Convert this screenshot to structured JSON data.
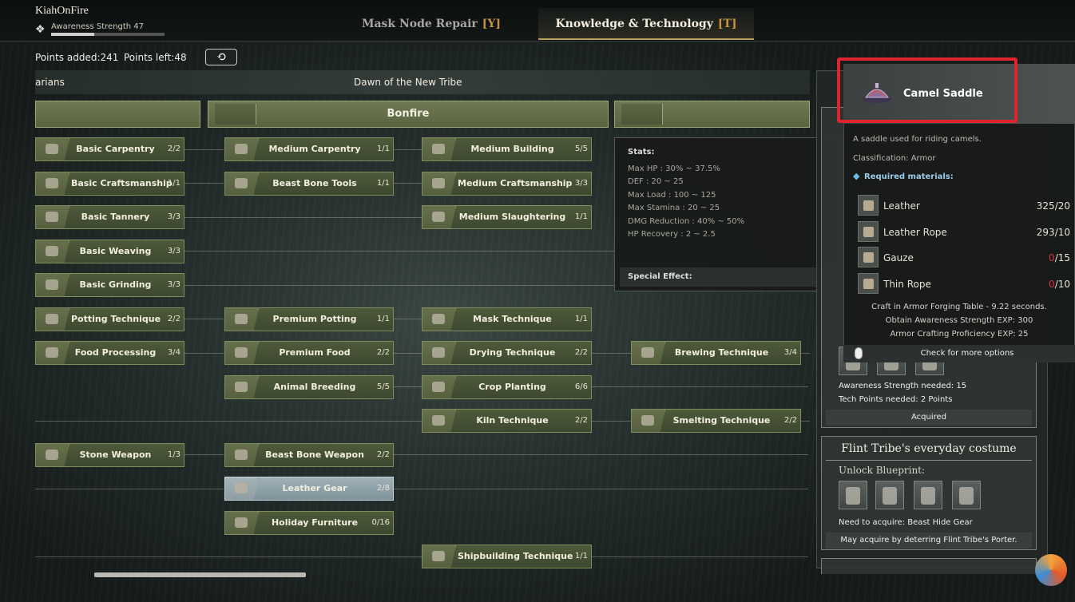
{
  "player": {
    "name": "KiahOnFire",
    "awareness_label": "Awareness Strength 47",
    "awareness_progress": 0.38
  },
  "tabs": [
    {
      "label": "Mask Node Repair",
      "key": "[Y]"
    },
    {
      "label": "Knowledge & Technology",
      "key": "[T]",
      "active": true
    }
  ],
  "points": {
    "added": "Points added:241",
    "left": "Points left:48",
    "reset_icon": "refresh-icon"
  },
  "eras": {
    "prev": "arians",
    "current": "Dawn of the New Tribe"
  },
  "categories": {
    "left": "",
    "center": "Bonfire",
    "right": ""
  },
  "nodes": [
    {
      "label": "Basic Carpentry",
      "count": "2/2"
    },
    {
      "label": "Basic Craftsmanship",
      "count": "1/1"
    },
    {
      "label": "Basic Tannery",
      "count": "3/3"
    },
    {
      "label": "Basic Weaving",
      "count": "3/3"
    },
    {
      "label": "Basic Grinding",
      "count": "3/3"
    },
    {
      "label": "Potting Technique",
      "count": "2/2"
    },
    {
      "label": "Food Processing",
      "count": "3/4"
    },
    {
      "label": "Stone Weapon",
      "count": "1/3"
    },
    {
      "label": "Medium Carpentry",
      "count": "1/1"
    },
    {
      "label": "Beast Bone Tools",
      "count": "1/1"
    },
    {
      "label": "Premium Potting",
      "count": "1/1"
    },
    {
      "label": "Premium Food",
      "count": "2/2"
    },
    {
      "label": "Animal Breeding",
      "count": "5/5"
    },
    {
      "label": "Beast Bone Weapon",
      "count": "2/2"
    },
    {
      "label": "Leather Gear",
      "count": "2/8"
    },
    {
      "label": "Holiday Furniture",
      "count": "0/16"
    },
    {
      "label": "Medium Building",
      "count": "5/5"
    },
    {
      "label": "Medium Craftsmanship",
      "count": "3/3"
    },
    {
      "label": "Medium Slaughtering",
      "count": "1/1"
    },
    {
      "label": "Mask Technique",
      "count": "1/1"
    },
    {
      "label": "Drying Technique",
      "count": "2/2"
    },
    {
      "label": "Crop Planting",
      "count": "6/6"
    },
    {
      "label": "Kiln Technique",
      "count": "2/2"
    },
    {
      "label": "Shipbuilding Technique",
      "count": "1/1"
    },
    {
      "label": "Brewing Technique",
      "count": "3/4"
    },
    {
      "label": "Smelting Technique",
      "count": "2/2"
    }
  ],
  "stats": {
    "title": "Stats:",
    "lines": [
      "Max HP : 30% ~ 37.5%",
      "DEF : 20 ~ 25",
      "Max Load : 100 ~ 125",
      "Max Stamina : 20 ~ 25",
      "DMG Reduction : 40% ~ 50%",
      "HP Recovery : 2 ~ 2.5"
    ],
    "special": "Special Effect:"
  },
  "item": {
    "name": "Camel Saddle",
    "description": "A saddle used for riding camels.",
    "classification": "Classification: Armor",
    "required_label": "Required materials:",
    "materials": [
      {
        "name": "Leather",
        "have": "325",
        "need": "/20",
        "short": false
      },
      {
        "name": "Leather Rope",
        "have": "293",
        "need": "/10",
        "short": false
      },
      {
        "name": "Gauze",
        "have": "0",
        "need": "/15",
        "short": true
      },
      {
        "name": "Thin Rope",
        "have": "0",
        "need": "/10",
        "short": true
      }
    ],
    "craft_info": [
      "Craft in Armor Forging Table - 9.22 seconds.",
      "Obtain Awareness Strength EXP: 300",
      "Armor Crafting Proficiency EXP: 25"
    ],
    "more_options": "Check for more options"
  },
  "right_panel": {
    "awareness_needed": "Awareness Strength needed: 15",
    "tech_points_needed": "Tech Points needed: 2 Points",
    "status": "Acquired",
    "card2_title": "Flint Tribe's everyday costume",
    "unlock_label": "Unlock Blueprint:",
    "need_acquire": "Need to acquire: Beast Hide Gear",
    "may_acquire": "May acquire by deterring Flint Tribe's Porter."
  },
  "colors": {
    "highlight": "#e0242f",
    "node_green": "#4e5a3a",
    "accent_gold": "#c7923d",
    "shortage_red": "#e0303a",
    "selected_node": "#9fb0b7"
  }
}
